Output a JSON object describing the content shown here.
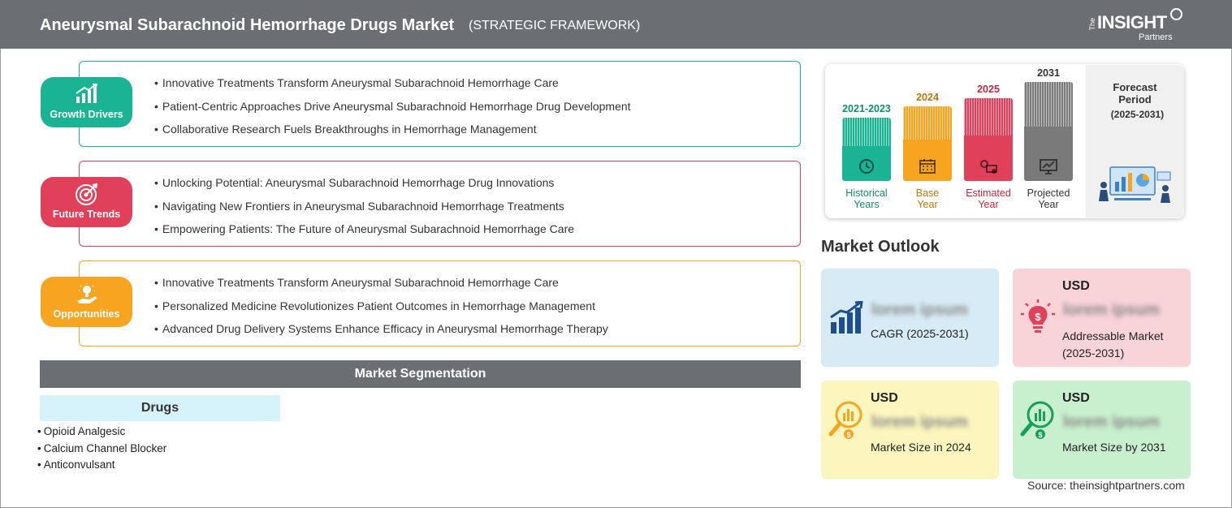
{
  "header": {
    "title": "Aneurysmal Subarachnoid Hemorrhage Drugs Market",
    "subtitle": "(STRATEGIC FRAMEWORK)",
    "logo": {
      "the": "The",
      "insight": "INSIGHT",
      "partners": "Partners"
    }
  },
  "panels": [
    {
      "badge": "Growth Drivers",
      "color": "#1ab394",
      "items": [
        "Innovative Treatments Transform Aneurysmal Subarachnoid Hemorrhage Care",
        "Patient-Centric Approaches Drive Aneurysmal Subarachnoid Hemorrhage Drug Development",
        "Collaborative Research Fuels Breakthroughs in Hemorrhage Management"
      ]
    },
    {
      "badge": "Future Trends",
      "color": "#e0405a",
      "items": [
        "Unlocking Potential: Aneurysmal Subarachnoid Hemorrhage Drug Innovations",
        "Navigating New Frontiers in Aneurysmal Subarachnoid Hemorrhage Treatments",
        "Empowering Patients: The Future of Aneurysmal Subarachnoid Hemorrhage Care"
      ]
    },
    {
      "badge": "Opportunities",
      "color": "#f7a520",
      "items": [
        "Innovative Treatments Transform Aneurysmal Subarachnoid Hemorrhage Care",
        "Personalized Medicine Revolutionizes Patient Outcomes in Hemorrhage Management",
        "Advanced Drug Delivery Systems Enhance Efficacy in Aneurysmal Hemorrhage Therapy"
      ]
    }
  ],
  "segmentation": {
    "title": "Market Segmentation",
    "category": "Drugs",
    "items": [
      "Opioid Analgesic",
      "Calcium Channel Blocker",
      "Anticonvulsant"
    ]
  },
  "timeline": {
    "columns": [
      {
        "year": "2021-2023",
        "label_line1": "Historical",
        "label_line2": "Years",
        "color": "#1ab394",
        "text_color": "#138a6e"
      },
      {
        "year": "2024",
        "label_line1": "Base",
        "label_line2": "Year",
        "color": "#f7a520",
        "text_color": "#b8760a"
      },
      {
        "year": "2025",
        "label_line1": "Estimated",
        "label_line2": "Year",
        "color": "#e0405a",
        "text_color": "#c0283f"
      },
      {
        "year": "2031",
        "label_line1": "Projected",
        "label_line2": "Year",
        "color": "#7a7a7a",
        "text_color": "#333333"
      }
    ],
    "forecast_line1": "Forecast",
    "forecast_line2": "Period",
    "forecast_range": "(2025-2031)"
  },
  "outlook": {
    "title": "Market Outlook",
    "cards": [
      {
        "usd": "",
        "value": "lorem ipsum",
        "desc_line1": "CAGR (2025-2031)",
        "desc_line2": "",
        "bg": "#d7ebf6",
        "icon": "bar-chart-growth-icon"
      },
      {
        "usd": "USD",
        "value": "lorem ipsum",
        "desc_line1": "Addressable Market",
        "desc_line2": "(2025-2031)",
        "bg": "#f8d3d8",
        "icon": "lightbulb-dollar-icon"
      },
      {
        "usd": "USD",
        "value": "lorem ipsum",
        "desc_line1": "Market Size in 2024",
        "desc_line2": "",
        "bg": "#fbf6bd",
        "icon": "magnifier-chart-yellow-icon"
      },
      {
        "usd": "USD",
        "value": "lorem ipsum",
        "desc_line1": "Market Size by 2031",
        "desc_line2": "",
        "bg": "#c8f0cf",
        "icon": "magnifier-chart-green-icon"
      }
    ]
  },
  "source": "Source: theinsightpartners.com"
}
